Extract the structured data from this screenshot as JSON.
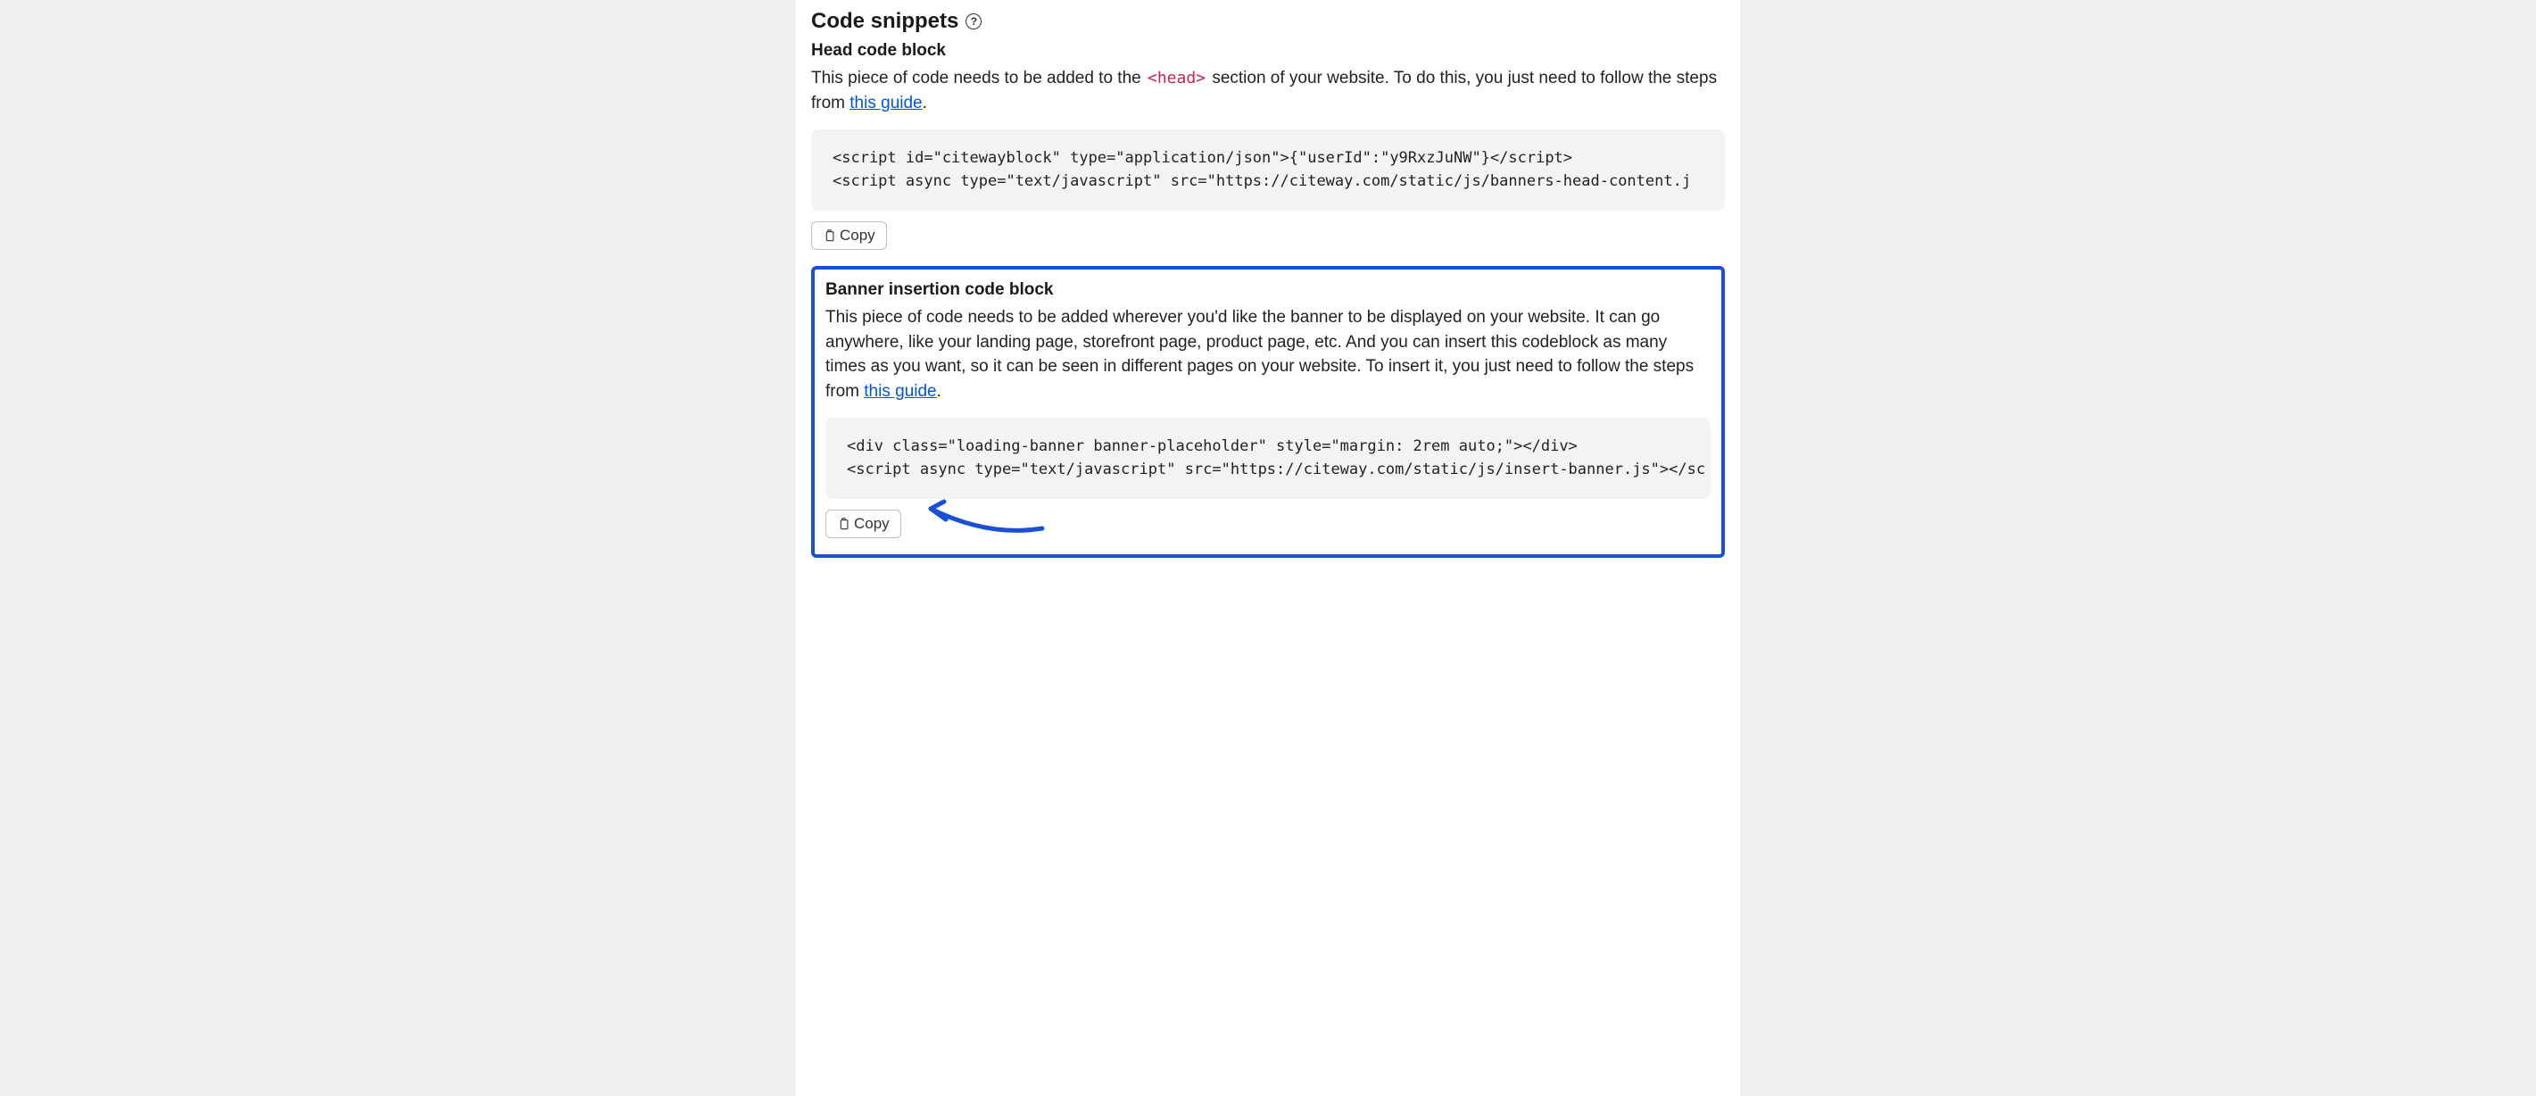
{
  "section": {
    "title": "Code snippets"
  },
  "head_block": {
    "title": "Head code block",
    "desc_before": "This piece of code needs to be added to the ",
    "head_tag": "<head>",
    "desc_middle": " section of your website. To do this, you just need to follow the steps from ",
    "guide_link": "this guide",
    "desc_after": ".",
    "code": "<script id=\"citewayblock\" type=\"application/json\">{\"userId\":\"y9RxzJuNW\"}</script>\n<script async type=\"text/javascript\" src=\"https://citeway.com/static/js/banners-head-content.j",
    "copy_label": "Copy"
  },
  "banner_block": {
    "title": "Banner insertion code block",
    "desc_before": "This piece of code needs to be added wherever you'd like the banner to be displayed on your website. It can go anywhere, like your landing page, storefront page, product page, etc. And you can insert this codeblock as many times as you want, so it can be seen in different pages on your website. To insert it, you just need to follow the steps from ",
    "guide_link": "this guide",
    "desc_after": ".",
    "code": "<div class=\"loading-banner banner-placeholder\" style=\"margin: 2rem auto;\"></div>\n<script async type=\"text/javascript\" src=\"https://citeway.com/static/js/insert-banner.js\"></sc",
    "copy_label": "Copy"
  }
}
